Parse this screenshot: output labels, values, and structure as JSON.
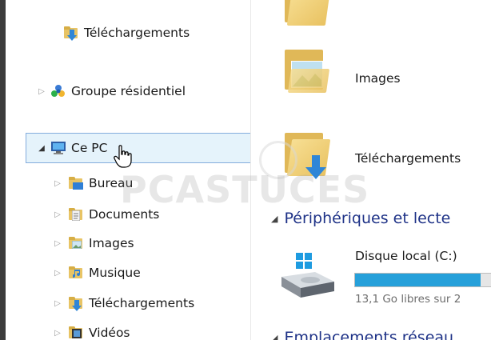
{
  "navigation": {
    "items": [
      {
        "label": "Téléchargements",
        "icon": "downloads-folder-icon",
        "indent": 0,
        "expand": "none"
      },
      {
        "label": "Groupe résidentiel",
        "icon": "homegroup-icon",
        "indent": 0,
        "expand": "collapsed"
      },
      {
        "label": "Ce PC",
        "icon": "computer-icon",
        "indent": 0,
        "expand": "expanded",
        "selected": true
      },
      {
        "label": "Bureau",
        "icon": "desktop-folder-icon",
        "indent": 1,
        "expand": "collapsed"
      },
      {
        "label": "Documents",
        "icon": "documents-folder-icon",
        "indent": 1,
        "expand": "collapsed"
      },
      {
        "label": "Images",
        "icon": "pictures-folder-icon",
        "indent": 1,
        "expand": "collapsed"
      },
      {
        "label": "Musique",
        "icon": "music-folder-icon",
        "indent": 1,
        "expand": "collapsed"
      },
      {
        "label": "Téléchargements",
        "icon": "downloads-folder-icon",
        "indent": 1,
        "expand": "collapsed"
      },
      {
        "label": "Vidéos",
        "icon": "videos-folder-icon",
        "indent": 1,
        "expand": "collapsed"
      }
    ]
  },
  "content": {
    "folders": [
      {
        "label": "Images",
        "icon": "pictures-large-folder-icon"
      },
      {
        "label": "Téléchargements",
        "icon": "downloads-large-folder-icon"
      }
    ],
    "devices_header": "Périphériques et lecte",
    "drive": {
      "label": "Disque local (C:)",
      "free_text": "13,1 Go libres sur 2",
      "used_fraction": 0.9,
      "icon": "local-disk-icon"
    },
    "network_header": "Emplacements réseau"
  },
  "watermark": "PCASTUCES",
  "colors": {
    "selection_bg": "#e5f3fb",
    "selection_border": "#84acdd",
    "section_header": "#1e3287",
    "progress": "#26a0da"
  }
}
